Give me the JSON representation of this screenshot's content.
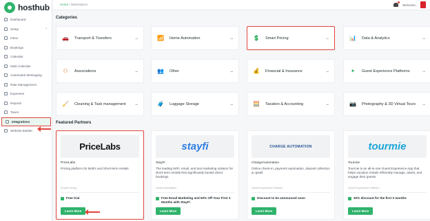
{
  "app": {
    "logo_text": "hosthub"
  },
  "topbar": {
    "crumb_home": "Home",
    "crumb_sep": "/",
    "crumb_page": "Marketplace",
    "welcome": "Welcome,"
  },
  "sidebar": {
    "items": [
      {
        "label": "Dashboard",
        "icon": "dashboard-icon"
      },
      {
        "label": "Setup",
        "icon": "gear-icon",
        "chevron": "›"
      },
      {
        "label": "Inbox",
        "icon": "inbox-icon"
      },
      {
        "label": "Bookings",
        "icon": "bookings-icon"
      },
      {
        "label": "Calendar",
        "icon": "calendar-icon"
      },
      {
        "label": "Multi Calendar",
        "icon": "multi-calendar-icon"
      },
      {
        "label": "Automated Messaging",
        "icon": "message-icon"
      },
      {
        "label": "Rate Management",
        "icon": "rate-icon"
      },
      {
        "label": "Expenses",
        "icon": "expenses-icon"
      },
      {
        "label": "Reports",
        "icon": "reports-icon"
      },
      {
        "label": "Taxes",
        "icon": "taxes-icon"
      },
      {
        "label": "Integrations",
        "icon": "integrations-icon"
      },
      {
        "label": "Website Builder",
        "icon": "website-icon"
      }
    ]
  },
  "categories": {
    "title": "Categories",
    "items": [
      {
        "label": "Transport & Transfers",
        "icon": "car-icon",
        "glyph": "🚗",
        "color": "#3aa76d"
      },
      {
        "label": "Home Automation",
        "icon": "wifi-home-icon",
        "glyph": "📶",
        "color": "#7a5bd6"
      },
      {
        "label": "Smart Pricing",
        "icon": "coin-icon",
        "glyph": "💲",
        "color": "#3b8fd9"
      },
      {
        "label": "Data & Analytics",
        "icon": "bar-chart-icon",
        "glyph": "📊",
        "color": "#d94a6a"
      },
      {
        "label": "Associations",
        "icon": "network-icon",
        "glyph": "⚇",
        "color": "#e07a2e"
      },
      {
        "label": "Other",
        "icon": "person-icon",
        "glyph": "👥",
        "color": "#2fb36b"
      },
      {
        "label": "Financial & Insurance",
        "icon": "coins-stack-icon",
        "glyph": "💰",
        "color": "#e6b422"
      },
      {
        "label": "Guest Experience Platforms",
        "icon": "puzzle-icon",
        "glyph": "✦",
        "color": "#2fb36b"
      },
      {
        "label": "Cleaning & Task management",
        "icon": "broom-icon",
        "glyph": "🧹",
        "color": "#333333"
      },
      {
        "label": "Luggage Storage",
        "icon": "luggage-icon",
        "glyph": "🧳",
        "color": "#c89b3c"
      },
      {
        "label": "Taxation & Accounting",
        "icon": "calculator-icon",
        "glyph": "🧮",
        "color": "#555555"
      },
      {
        "label": "Photography & 3D Virtual Tours",
        "icon": "camera-icon",
        "glyph": "📷",
        "color": "#2fb36b"
      }
    ]
  },
  "partners": {
    "title": "Featured Partners",
    "button_label": "Learn More",
    "items": [
      {
        "logo": "PriceLabs",
        "name": "PriceLabs",
        "desc": "Pricing platform for BnB's and Short-term rentals",
        "category": "Smart Pricing",
        "offer": "Free trial"
      },
      {
        "logo": "stayfi",
        "name": "StayFi",
        "desc": "The leading WiFi, email, and text marketing solution for short-term rentals that significantly boosts direct bookings",
        "category": "Home Automation",
        "offer": "Free Email Marketing and 50% Off Your First 3 Months with StayFi"
      },
      {
        "logo": "CHARGE AUTOMATION",
        "name": "ChargeAutomation",
        "desc": "Online check-in, payment automation, deposit collection & upsell.",
        "category": "Guest Experience Platform",
        "offer": "Discount to be announced soon"
      },
      {
        "logo": "tourmie",
        "name": "Tourmie",
        "desc": "Tourmie is an all-in-one Guest Experience App that helps vacation rentals efficiently manage, assist, and engage their guests.",
        "category": "Guest Experience Platform",
        "offer": "30% discount for the first 3 months"
      }
    ]
  }
}
